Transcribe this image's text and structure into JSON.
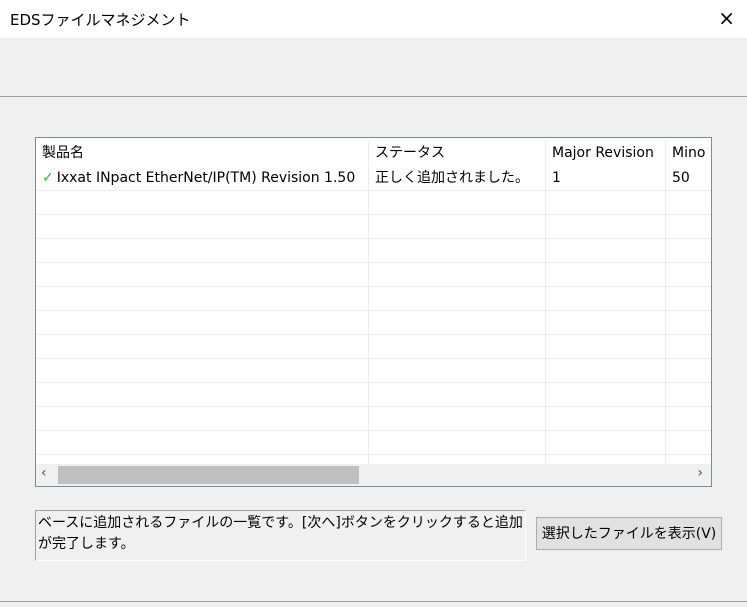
{
  "window": {
    "title": "EDSファイルマネジメント",
    "close_icon": "×"
  },
  "table": {
    "columns": [
      "製品名",
      "ステータス",
      "Major Revision",
      "Mino"
    ],
    "rows": [
      {
        "name": "Ixxat INpact EtherNet/IP(TM) Revision 1.50",
        "status": "正しく追加されました。",
        "major": "1",
        "minor": "50",
        "icon": "check-icon"
      }
    ]
  },
  "info_text": "ベースに追加されるファイルの一覧です。[次へ]ボタンをクリックすると追加が完了します。",
  "view_button": "選択したファイルを表示(V)",
  "colors": {
    "check": "#22c020"
  }
}
